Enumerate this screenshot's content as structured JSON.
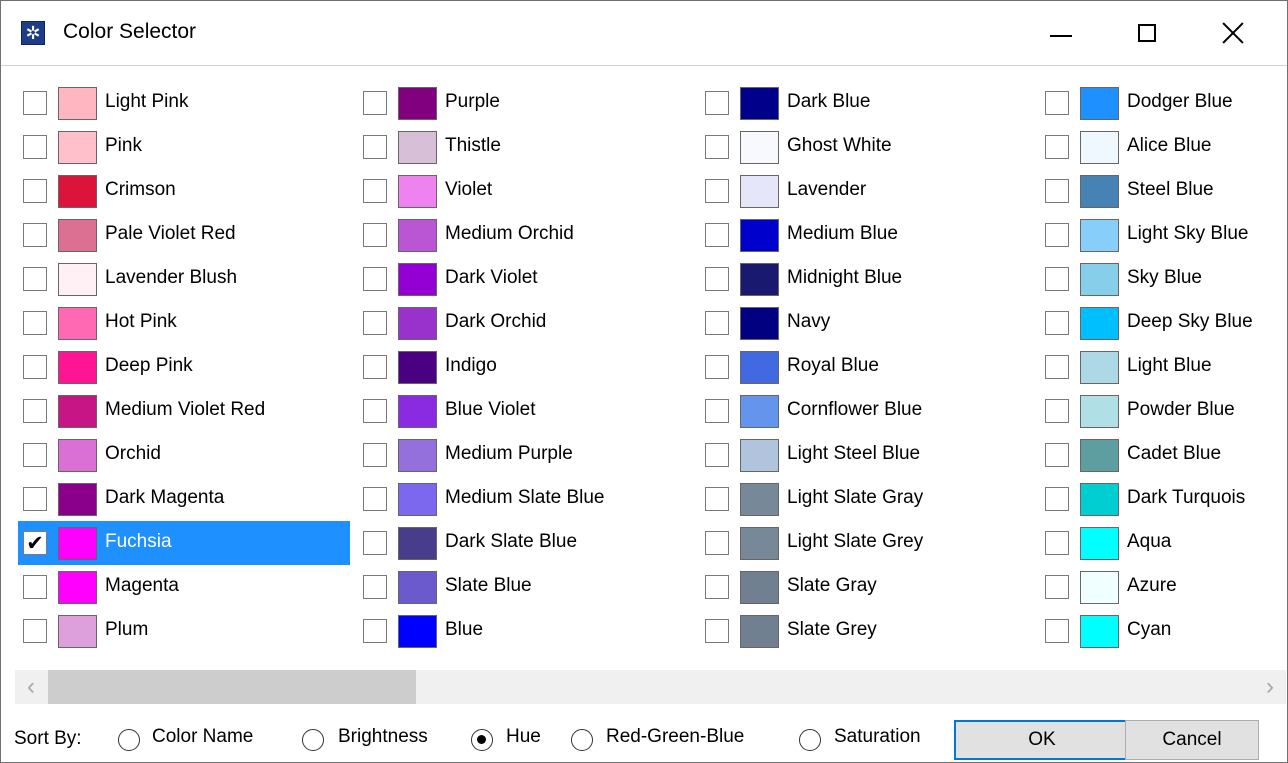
{
  "window": {
    "title": "Color Selector"
  },
  "columns": [
    [
      {
        "name": "Light Pink",
        "color": "#FFB6C1",
        "checked": false
      },
      {
        "name": "Pink",
        "color": "#FFC0CB",
        "checked": false
      },
      {
        "name": "Crimson",
        "color": "#DC143C",
        "checked": false
      },
      {
        "name": "Pale Violet Red",
        "color": "#DB7093",
        "checked": false
      },
      {
        "name": "Lavender Blush",
        "color": "#FFF0F5",
        "checked": false
      },
      {
        "name": "Hot Pink",
        "color": "#FF69B4",
        "checked": false
      },
      {
        "name": "Deep Pink",
        "color": "#FF1493",
        "checked": false
      },
      {
        "name": "Medium Violet Red",
        "color": "#C71585",
        "checked": false
      },
      {
        "name": "Orchid",
        "color": "#DA70D6",
        "checked": false
      },
      {
        "name": "Dark Magenta",
        "color": "#8B008B",
        "checked": false
      },
      {
        "name": "Fuchsia",
        "color": "#FF00FF",
        "checked": true,
        "selected": true
      },
      {
        "name": "Magenta",
        "color": "#FF00FF",
        "checked": false
      },
      {
        "name": "Plum",
        "color": "#DDA0DD",
        "checked": false
      }
    ],
    [
      {
        "name": "Purple",
        "color": "#800080",
        "checked": false
      },
      {
        "name": "Thistle",
        "color": "#D8BFD8",
        "checked": false
      },
      {
        "name": "Violet",
        "color": "#EE82EE",
        "checked": false
      },
      {
        "name": "Medium Orchid",
        "color": "#BA55D3",
        "checked": false
      },
      {
        "name": "Dark Violet",
        "color": "#9400D3",
        "checked": false
      },
      {
        "name": "Dark Orchid",
        "color": "#9932CC",
        "checked": false
      },
      {
        "name": "Indigo",
        "color": "#4B0082",
        "checked": false
      },
      {
        "name": "Blue Violet",
        "color": "#8A2BE2",
        "checked": false
      },
      {
        "name": "Medium Purple",
        "color": "#9370DB",
        "checked": false
      },
      {
        "name": "Medium Slate Blue",
        "color": "#7B68EE",
        "checked": false
      },
      {
        "name": "Dark Slate Blue",
        "color": "#483D8B",
        "checked": false
      },
      {
        "name": "Slate Blue",
        "color": "#6A5ACD",
        "checked": false
      },
      {
        "name": "Blue",
        "color": "#0000FF",
        "checked": false
      }
    ],
    [
      {
        "name": "Dark Blue",
        "color": "#00008B",
        "checked": false
      },
      {
        "name": "Ghost White",
        "color": "#F8F8FF",
        "checked": false
      },
      {
        "name": "Lavender",
        "color": "#E6E6FA",
        "checked": false
      },
      {
        "name": "Medium Blue",
        "color": "#0000CD",
        "checked": false
      },
      {
        "name": "Midnight Blue",
        "color": "#191970",
        "checked": false
      },
      {
        "name": "Navy",
        "color": "#000080",
        "checked": false
      },
      {
        "name": "Royal Blue",
        "color": "#4169E1",
        "checked": false
      },
      {
        "name": "Cornflower Blue",
        "color": "#6495ED",
        "checked": false
      },
      {
        "name": "Light Steel Blue",
        "color": "#B0C4DE",
        "checked": false
      },
      {
        "name": "Light Slate Gray",
        "color": "#778899",
        "checked": false
      },
      {
        "name": "Light Slate Grey",
        "color": "#778899",
        "checked": false
      },
      {
        "name": "Slate Gray",
        "color": "#708090",
        "checked": false
      },
      {
        "name": "Slate Grey",
        "color": "#708090",
        "checked": false
      }
    ],
    [
      {
        "name": "Dodger Blue",
        "color": "#1E90FF",
        "checked": false
      },
      {
        "name": "Alice Blue",
        "color": "#F0F8FF",
        "checked": false
      },
      {
        "name": "Steel Blue",
        "color": "#4682B4",
        "checked": false
      },
      {
        "name": "Light Sky Blue",
        "color": "#87CEFA",
        "checked": false
      },
      {
        "name": "Sky Blue",
        "color": "#87CEEB",
        "checked": false
      },
      {
        "name": "Deep Sky Blue",
        "color": "#00BFFF",
        "checked": false
      },
      {
        "name": "Light Blue",
        "color": "#ADD8E6",
        "checked": false
      },
      {
        "name": "Powder Blue",
        "color": "#B0E0E6",
        "checked": false
      },
      {
        "name": "Cadet Blue",
        "color": "#5F9EA0",
        "checked": false
      },
      {
        "name": "Dark Turquois",
        "color": "#00CED1",
        "checked": false
      },
      {
        "name": "Aqua",
        "color": "#00FFFF",
        "checked": false
      },
      {
        "name": "Azure",
        "color": "#F0FFFF",
        "checked": false
      },
      {
        "name": "Cyan",
        "color": "#00FFFF",
        "checked": false
      }
    ]
  ],
  "scrollbar": {
    "left_arrow": "‹",
    "right_arrow": "›"
  },
  "sort": {
    "label": "Sort By:",
    "options": [
      "Color Name",
      "Brightness",
      "Hue",
      "Red-Green-Blue",
      "Saturation"
    ],
    "selected": "Hue"
  },
  "buttons": {
    "ok": "OK",
    "cancel": "Cancel"
  },
  "check_glyph": "✔",
  "app_icon_glyph": "✲",
  "accent_color": "#1E90FF"
}
